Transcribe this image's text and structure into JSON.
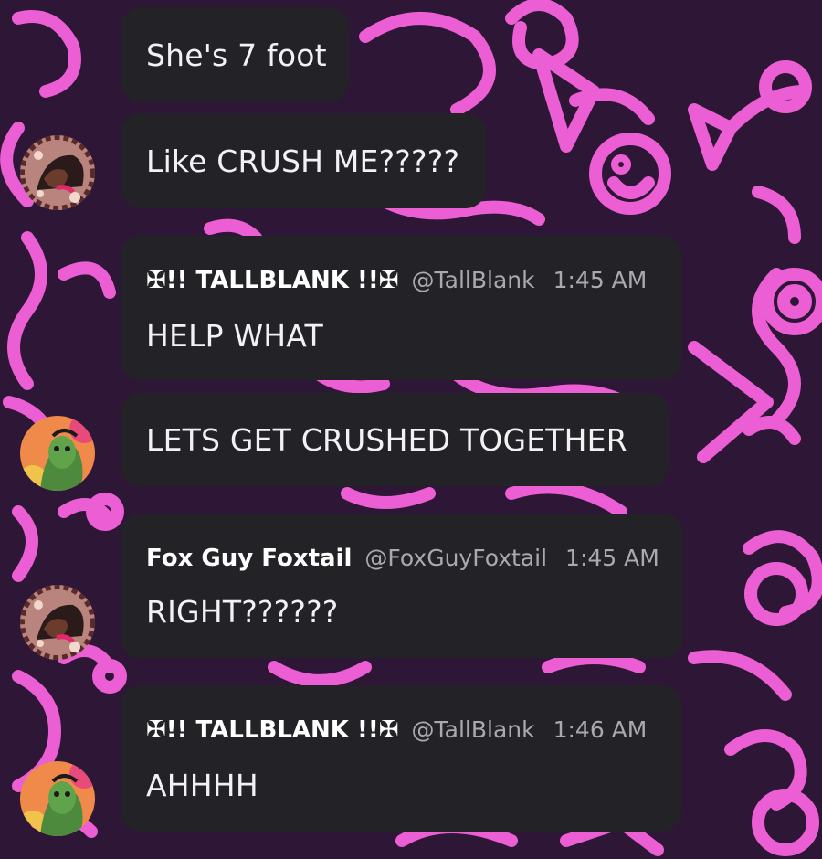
{
  "colors": {
    "background": "#2e1636",
    "doodle": "#ec5fd4",
    "bubble": "#232327",
    "text": "#f2f2f4",
    "meta": "#a9a9b0"
  },
  "messages": [
    {
      "text": "She's 7 foot"
    },
    {
      "text": "Like CRUSH ME?????",
      "avatar": "fox-avatar-icon"
    },
    {
      "author": "✠!! TALLBLANK !!✠",
      "handle": "@TallBlank",
      "time": "1:45 AM",
      "text": "HELP WHAT"
    },
    {
      "text": "LETS GET CRUSHED TOGETHER",
      "avatar": "tallblank-avatar-icon"
    },
    {
      "author": "Fox Guy Foxtail",
      "handle": "@FoxGuyFoxtail",
      "time": "1:45 AM",
      "text": "RIGHT??????",
      "avatar": "fox-avatar-icon"
    },
    {
      "author": "✠!! TALLBLANK !!✠",
      "handle": "@TallBlank",
      "time": "1:46 AM",
      "text": "AHHHH",
      "avatar": "tallblank-avatar-icon"
    }
  ]
}
